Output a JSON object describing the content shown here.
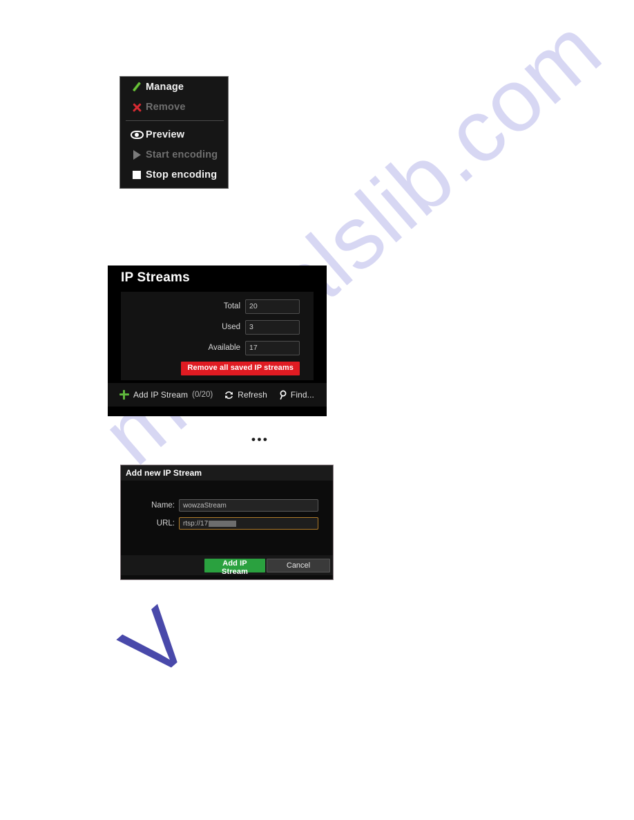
{
  "context_menu": {
    "groups": [
      {
        "items": [
          {
            "label": "Manage",
            "icon": "pencil-icon",
            "disabled": false
          },
          {
            "label": "Remove",
            "icon": "x-icon",
            "disabled": true
          }
        ]
      },
      {
        "items": [
          {
            "label": "Preview",
            "icon": "eye-icon",
            "disabled": false
          },
          {
            "label": "Start encoding",
            "icon": "play-icon",
            "disabled": true
          },
          {
            "label": "Stop encoding",
            "icon": "stop-icon",
            "disabled": false
          }
        ]
      }
    ]
  },
  "ip_streams_panel": {
    "title": "IP Streams",
    "fields": [
      {
        "label": "Total",
        "value": "20"
      },
      {
        "label": "Used",
        "value": "3"
      },
      {
        "label": "Available",
        "value": "17"
      }
    ],
    "remove_all_label": "Remove all saved IP streams",
    "remove_all_color": "#e01b22",
    "toolbar": {
      "add_label": "Add IP Stream",
      "add_count": "(0/20)",
      "refresh_label": "Refresh",
      "find_label": "Find..."
    }
  },
  "separator": {
    "ellipsis": "•••"
  },
  "add_stream_dialog": {
    "title": "Add new IP Stream",
    "name_label": "Name:",
    "name_value": "wowzaStream",
    "url_label": "URL:",
    "url_value": "rtsp://17",
    "url_redacted": true,
    "confirm_label": "Add IP Stream",
    "confirm_color": "#2aa13f",
    "cancel_label": "Cancel"
  },
  "watermark": {
    "text": "manualslib.com",
    "color": "#c9c9ef"
  }
}
